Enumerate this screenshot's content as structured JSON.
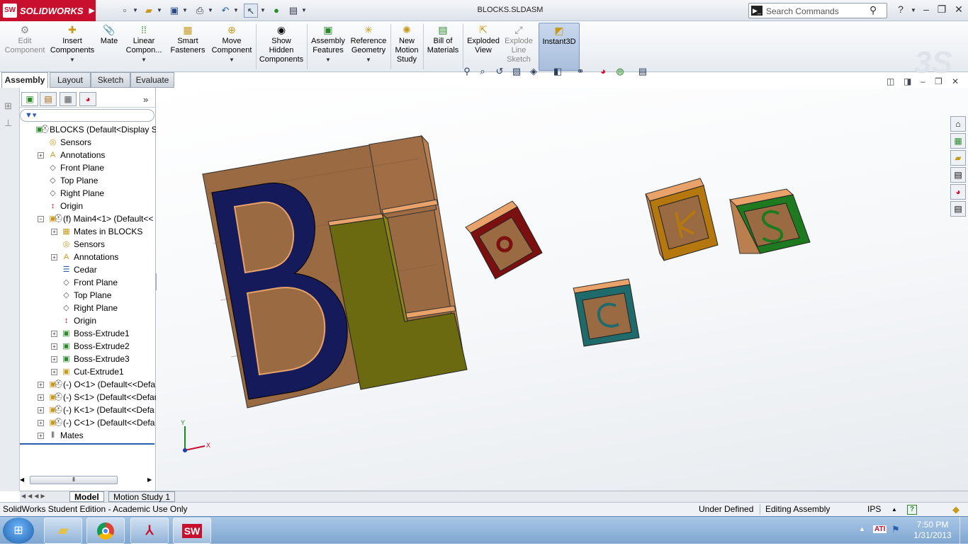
{
  "app": {
    "brand": "SOLIDWORKS",
    "document_title": "BLOCKS.SLDASM"
  },
  "search": {
    "placeholder": "Search Commands"
  },
  "command_manager": {
    "buttons": [
      {
        "label": "Edit\nComponent",
        "enabled": false
      },
      {
        "label": "Insert\nComponents",
        "enabled": true
      },
      {
        "label": "Mate",
        "enabled": true
      },
      {
        "label": "Linear\nCompon...",
        "enabled": true
      },
      {
        "label": "Smart\nFasteners",
        "enabled": true
      },
      {
        "label": "Move\nComponent",
        "enabled": true
      },
      {
        "label": "Show\nHidden\nComponents",
        "enabled": true
      },
      {
        "label": "Assembly\nFeatures",
        "enabled": true
      },
      {
        "label": "Reference\nGeometry",
        "enabled": true
      },
      {
        "label": "New\nMotion\nStudy",
        "enabled": true
      },
      {
        "label": "Bill of\nMaterials",
        "enabled": true
      },
      {
        "label": "Exploded\nView",
        "enabled": true
      },
      {
        "label": "Explode\nLine\nSketch",
        "enabled": false
      },
      {
        "label": "Instant3D",
        "enabled": true,
        "active": true
      }
    ]
  },
  "tabs": [
    {
      "label": "Assembly",
      "active": true
    },
    {
      "label": "Layout"
    },
    {
      "label": "Sketch"
    },
    {
      "label": "Evaluate"
    }
  ],
  "feature_tree": [
    {
      "label": "BLOCKS  (Default<Display St",
      "icon": "assembly-icon",
      "expander": ""
    },
    {
      "label": "Sensors",
      "icon": "sensor-icon",
      "expander": ""
    },
    {
      "label": "Annotations",
      "icon": "annotation-icon",
      "expander": "+"
    },
    {
      "label": "Front Plane",
      "icon": "plane-icon",
      "expander": ""
    },
    {
      "label": "Top Plane",
      "icon": "plane-icon",
      "expander": ""
    },
    {
      "label": "Right Plane",
      "icon": "plane-icon",
      "expander": ""
    },
    {
      "label": "Origin",
      "icon": "origin-icon",
      "expander": ""
    },
    {
      "label": "(f) Main4<1> (Default<<",
      "icon": "part-icon",
      "expander": "-"
    },
    {
      "label": "Mates in BLOCKS",
      "icon": "mates-folder-icon",
      "expander": "+"
    },
    {
      "label": "Sensors",
      "icon": "sensor-icon",
      "expander": ""
    },
    {
      "label": "Annotations",
      "icon": "annotation-icon",
      "expander": "+"
    },
    {
      "label": "Cedar",
      "icon": "material-icon",
      "expander": ""
    },
    {
      "label": "Front Plane",
      "icon": "plane-icon",
      "expander": ""
    },
    {
      "label": "Top Plane",
      "icon": "plane-icon",
      "expander": ""
    },
    {
      "label": "Right Plane",
      "icon": "plane-icon",
      "expander": ""
    },
    {
      "label": "Origin",
      "icon": "origin-icon",
      "expander": ""
    },
    {
      "label": "Boss-Extrude1",
      "icon": "extrude-icon",
      "expander": "+"
    },
    {
      "label": "Boss-Extrude2",
      "icon": "extrude-icon",
      "expander": "+"
    },
    {
      "label": "Boss-Extrude3",
      "icon": "extrude-icon",
      "expander": "+"
    },
    {
      "label": "Cut-Extrude1",
      "icon": "cut-extrude-icon",
      "expander": "+"
    },
    {
      "label": "(-) O<1> (Default<<Defa",
      "icon": "part-icon",
      "expander": "+"
    },
    {
      "label": "(-) S<1> (Default<<Defau",
      "icon": "part-icon",
      "expander": "+"
    },
    {
      "label": "(-) K<1> (Default<<Defa",
      "icon": "part-icon",
      "expander": "+"
    },
    {
      "label": "(-) C<1> (Default<<Defa",
      "icon": "part-icon",
      "expander": "+"
    },
    {
      "label": "Mates",
      "icon": "mates-icon",
      "expander": "+"
    }
  ],
  "bottom_tabs": [
    {
      "label": "Model",
      "active": true
    },
    {
      "label": "Motion Study 1"
    }
  ],
  "status": {
    "left": "SolidWorks Student Edition - Academic Use Only",
    "state": "Under Defined",
    "mode": "Editing Assembly",
    "units": "IPS"
  },
  "model": {
    "big_letters": [
      "B",
      "L"
    ],
    "blocks": [
      {
        "letter": "O",
        "color": "#7a1010"
      },
      {
        "letter": "K",
        "color": "#b5780e"
      },
      {
        "letter": "S",
        "color": "#1e7a1e"
      },
      {
        "letter": "C",
        "color": "#1f6a6a"
      }
    ],
    "triad": {
      "x_label": "X",
      "y_label": "Y"
    }
  },
  "taskbar": {
    "time": "7:50 PM",
    "date": "1/31/2013",
    "apps": [
      "windows-explorer",
      "chrome",
      "acrobat",
      "solidworks"
    ]
  },
  "colors": {
    "wood": "#9a6a43",
    "wood_light": "#e8a26a",
    "navy": "#151a5a",
    "olive": "#6b6a10",
    "title_red": "#c8102e"
  }
}
